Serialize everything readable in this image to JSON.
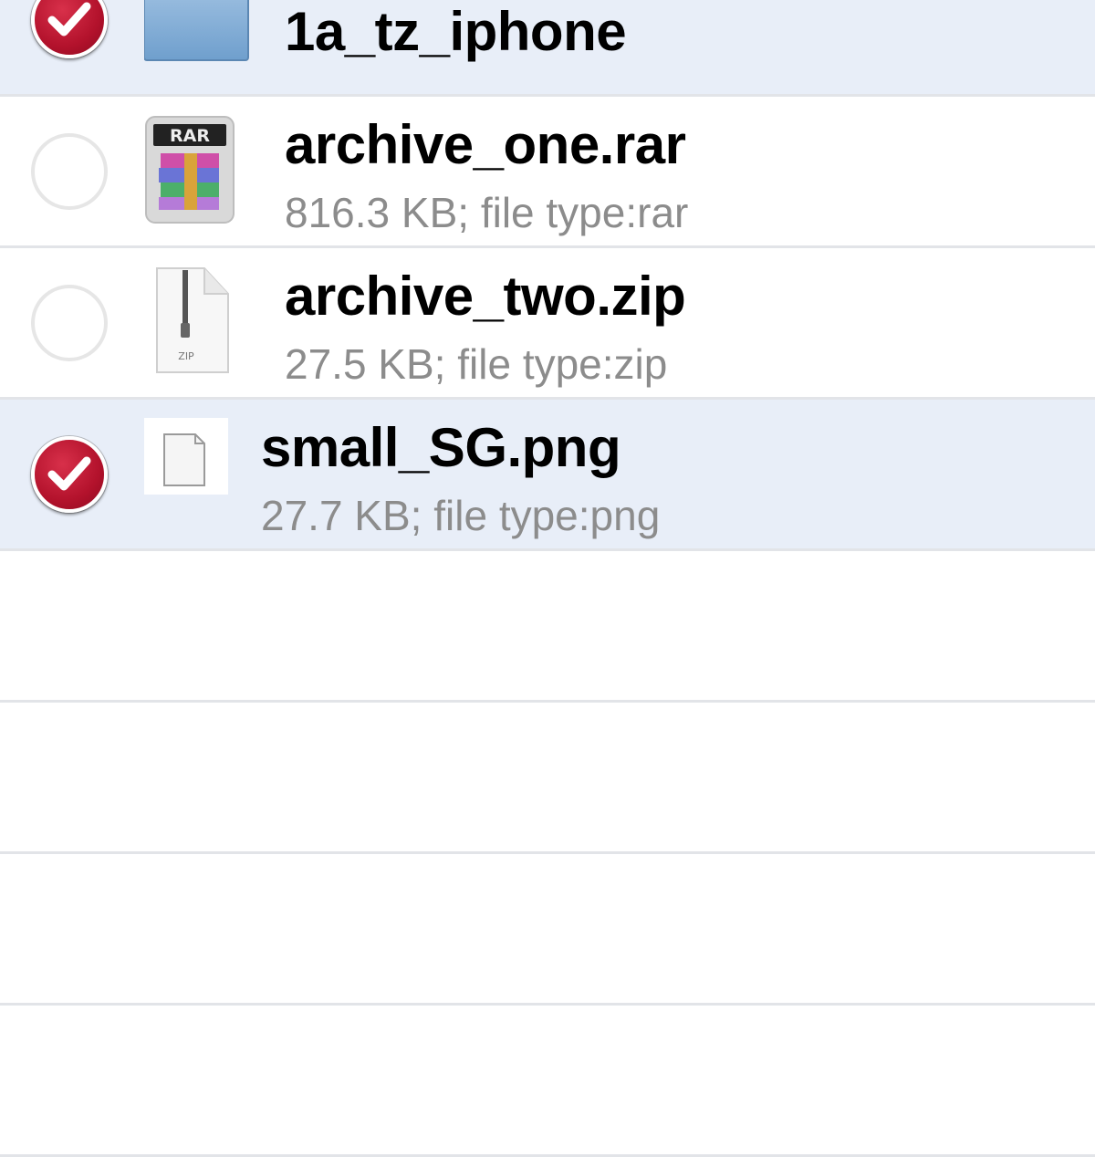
{
  "files": [
    {
      "name": "1a_tz_iphone",
      "meta": "",
      "icon": "folder-icon",
      "checked": true
    },
    {
      "name": "archive_one.rar",
      "meta": "816.3 KB; file type:rar",
      "icon": "rar-archive-icon",
      "checked": false
    },
    {
      "name": "archive_two.zip",
      "meta": "27.5 KB; file type:zip",
      "icon": "zip-file-icon",
      "checked": false
    },
    {
      "name": "small_SG.png",
      "meta": "27.7 KB; file type:png",
      "icon": "png-file-icon",
      "checked": true
    }
  ],
  "icon_labels": {
    "rar": "RAR",
    "zip": "ZIP"
  },
  "colors": {
    "selected_row": "#e8eef8",
    "check_red": "#b3122c",
    "meta_text": "#8c8c8c"
  }
}
